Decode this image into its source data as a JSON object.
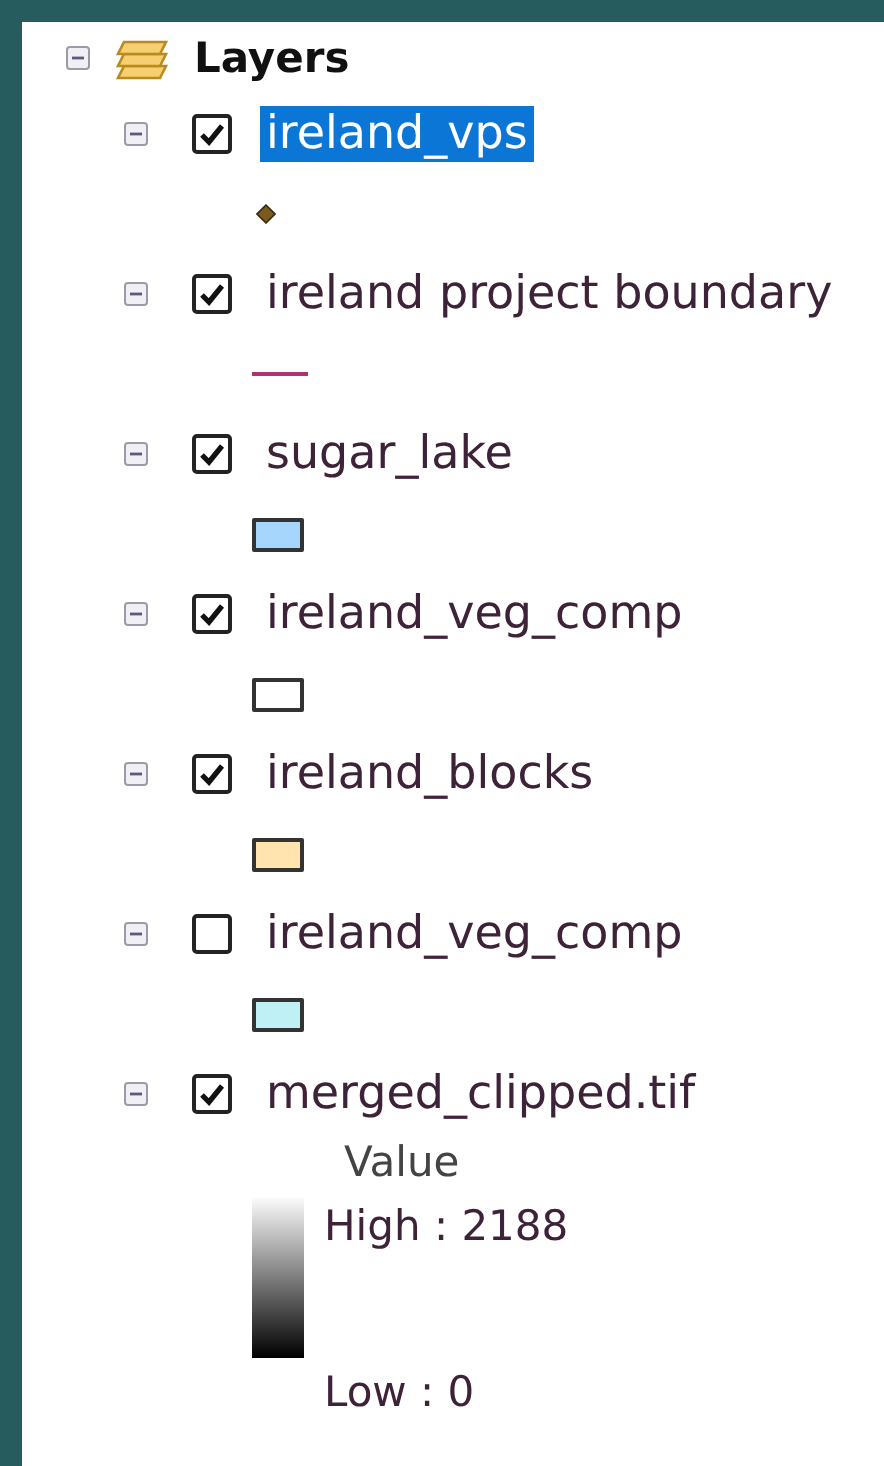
{
  "panel": {
    "title": "Layers",
    "expanded": true
  },
  "layers": [
    {
      "name": "ireland_vps",
      "checked": true,
      "selected": true,
      "expanded": true,
      "symbol": {
        "kind": "marker",
        "color": "#7a5a1e"
      }
    },
    {
      "name": "ireland project boundary",
      "checked": true,
      "selected": false,
      "expanded": true,
      "symbol": {
        "kind": "line",
        "color": "#b03070"
      }
    },
    {
      "name": "sugar_lake",
      "checked": true,
      "selected": false,
      "expanded": true,
      "symbol": {
        "kind": "fill",
        "color": "#a6d6fb"
      }
    },
    {
      "name": "ireland_veg_comp",
      "checked": true,
      "selected": false,
      "expanded": true,
      "symbol": {
        "kind": "fill",
        "color": "#ffffff"
      }
    },
    {
      "name": "ireland_blocks",
      "checked": true,
      "selected": false,
      "expanded": true,
      "symbol": {
        "kind": "fill",
        "color": "#ffe4b0"
      }
    },
    {
      "name": "ireland_veg_comp",
      "checked": false,
      "selected": false,
      "expanded": true,
      "symbol": {
        "kind": "fill",
        "color": "#bff0f5"
      }
    },
    {
      "name": "merged_clipped.tif",
      "checked": true,
      "selected": false,
      "expanded": true,
      "symbol": {
        "kind": "ramp",
        "field": "Value",
        "high": "High : 2188",
        "low": "Low : 0"
      }
    }
  ]
}
